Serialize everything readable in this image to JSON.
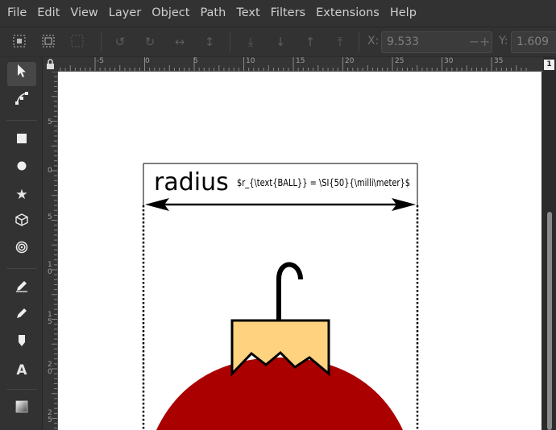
{
  "menu": [
    "File",
    "Edit",
    "View",
    "Layer",
    "Object",
    "Path",
    "Text",
    "Filters",
    "Extensions",
    "Help"
  ],
  "toolbar": {
    "icons": [
      "select-all-icon",
      "select-all-layers-icon",
      "deselect-icon",
      "rotate-ccw-icon",
      "rotate-cw-icon",
      "flip-horizontal-icon",
      "flip-vertical-icon",
      "lower-to-bottom-icon",
      "lower-icon",
      "raise-icon",
      "raise-to-top-icon"
    ],
    "x_label": "X:",
    "x_value": "9.533",
    "y_label": "Y:",
    "y_value": "1.609"
  },
  "tools": [
    "selector-tool-icon",
    "node-tool-icon",
    "rectangle-tool-icon",
    "ellipse-tool-icon",
    "star-tool-icon",
    "3d-box-tool-icon",
    "spiral-tool-icon",
    "pencil-tool-icon",
    "pen-tool-icon",
    "calligraphy-tool-icon",
    "text-tool-icon",
    "gradient-tool-icon"
  ],
  "ruler": {
    "h_labels": [
      "-5",
      "0",
      "5",
      "10",
      "15",
      "20",
      "25",
      "30",
      "35"
    ],
    "v_labels": [
      "5",
      "0",
      "5",
      "1\n0",
      "1\n5",
      "2\n0",
      "2\n5"
    ]
  },
  "page_badge": "1",
  "drawing": {
    "radius_word": "radius",
    "formula": "$r_{\\text{BALL}} = \\SI{50}{\\milli\\meter}$",
    "colors": {
      "ball": "#aa0000",
      "cap": "#ffd27f",
      "stroke": "#000000"
    }
  }
}
